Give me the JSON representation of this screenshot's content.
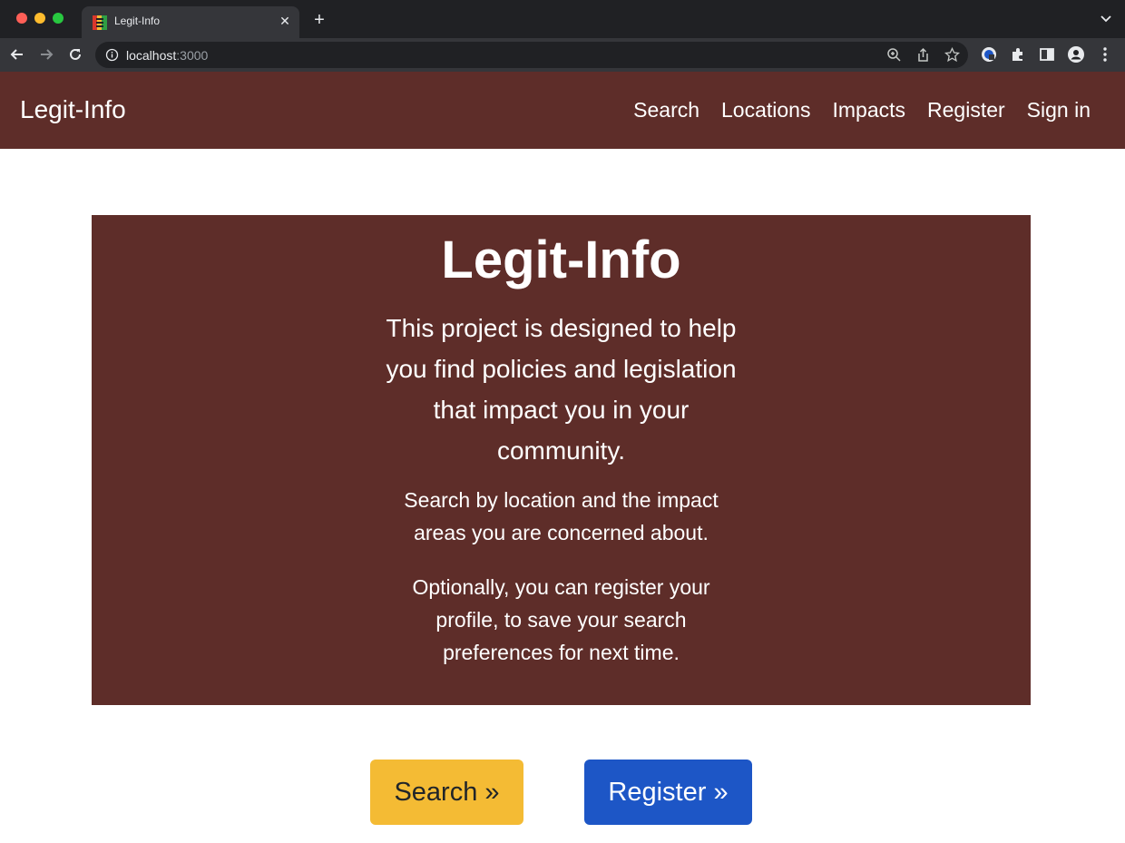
{
  "browser": {
    "tab_title": "Legit-Info",
    "tab_close": "✕",
    "new_tab": "+",
    "url_host": "localhost",
    "url_port": ":3000"
  },
  "navbar": {
    "brand": "Legit-Info",
    "links": [
      "Search",
      "Locations",
      "Impacts",
      "Register",
      "Sign in"
    ]
  },
  "hero": {
    "title": "Legit-Info",
    "lead": "This project is designed to help you find policies and legislation that impact you in your community.",
    "paragraph_1": "Search by location and the impact areas you are concerned about.",
    "paragraph_2": "Optionally, you can register your profile, to save your search preferences for next time."
  },
  "actions": {
    "search_label": "Search »",
    "register_label": "Register »"
  },
  "colors": {
    "brand_maroon": "#5e2d29",
    "search_button": "#f4bb34",
    "register_button": "#1d56c6"
  }
}
